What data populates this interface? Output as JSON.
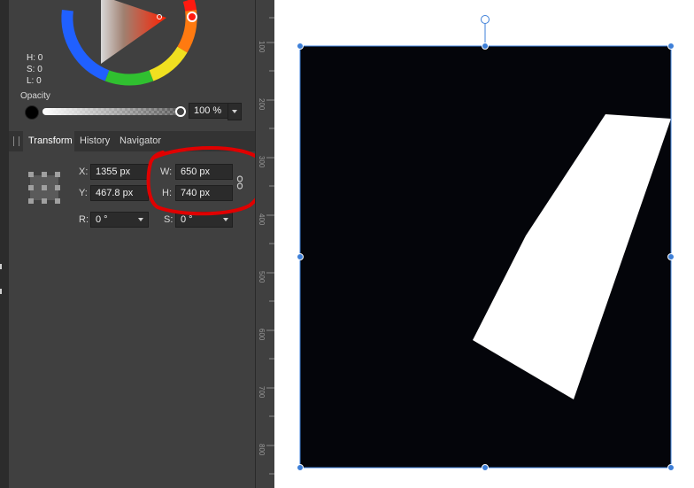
{
  "color_panel": {
    "h_label": "H: 0",
    "s_label": "S: 0",
    "l_label": "L: 0",
    "opacity_label": "Opacity",
    "opacity_value": "100 %",
    "opacity_level": 1.0
  },
  "tabs": {
    "transform": "Transform",
    "history": "History",
    "navigator": "Navigator"
  },
  "transform": {
    "x_label": "X:",
    "x_value": "1355 px",
    "y_label": "Y:",
    "y_value": "467.8 px",
    "w_label": "W:",
    "w_value": "650 px",
    "h_label": "H:",
    "h_value": "740 px",
    "r_label": "R:",
    "r_value": "0 °",
    "s_label": "S:",
    "s_value": "0 °"
  },
  "ruler": {
    "ticks": [
      "100",
      "200",
      "300",
      "400",
      "500",
      "600",
      "700",
      "800"
    ]
  },
  "colors": {
    "panel_bg": "#404040",
    "field_bg": "#2b2b2b",
    "selection_blue": "#3d7fd8",
    "annotation_red": "#e00000",
    "canvas_black": "#04050a"
  }
}
